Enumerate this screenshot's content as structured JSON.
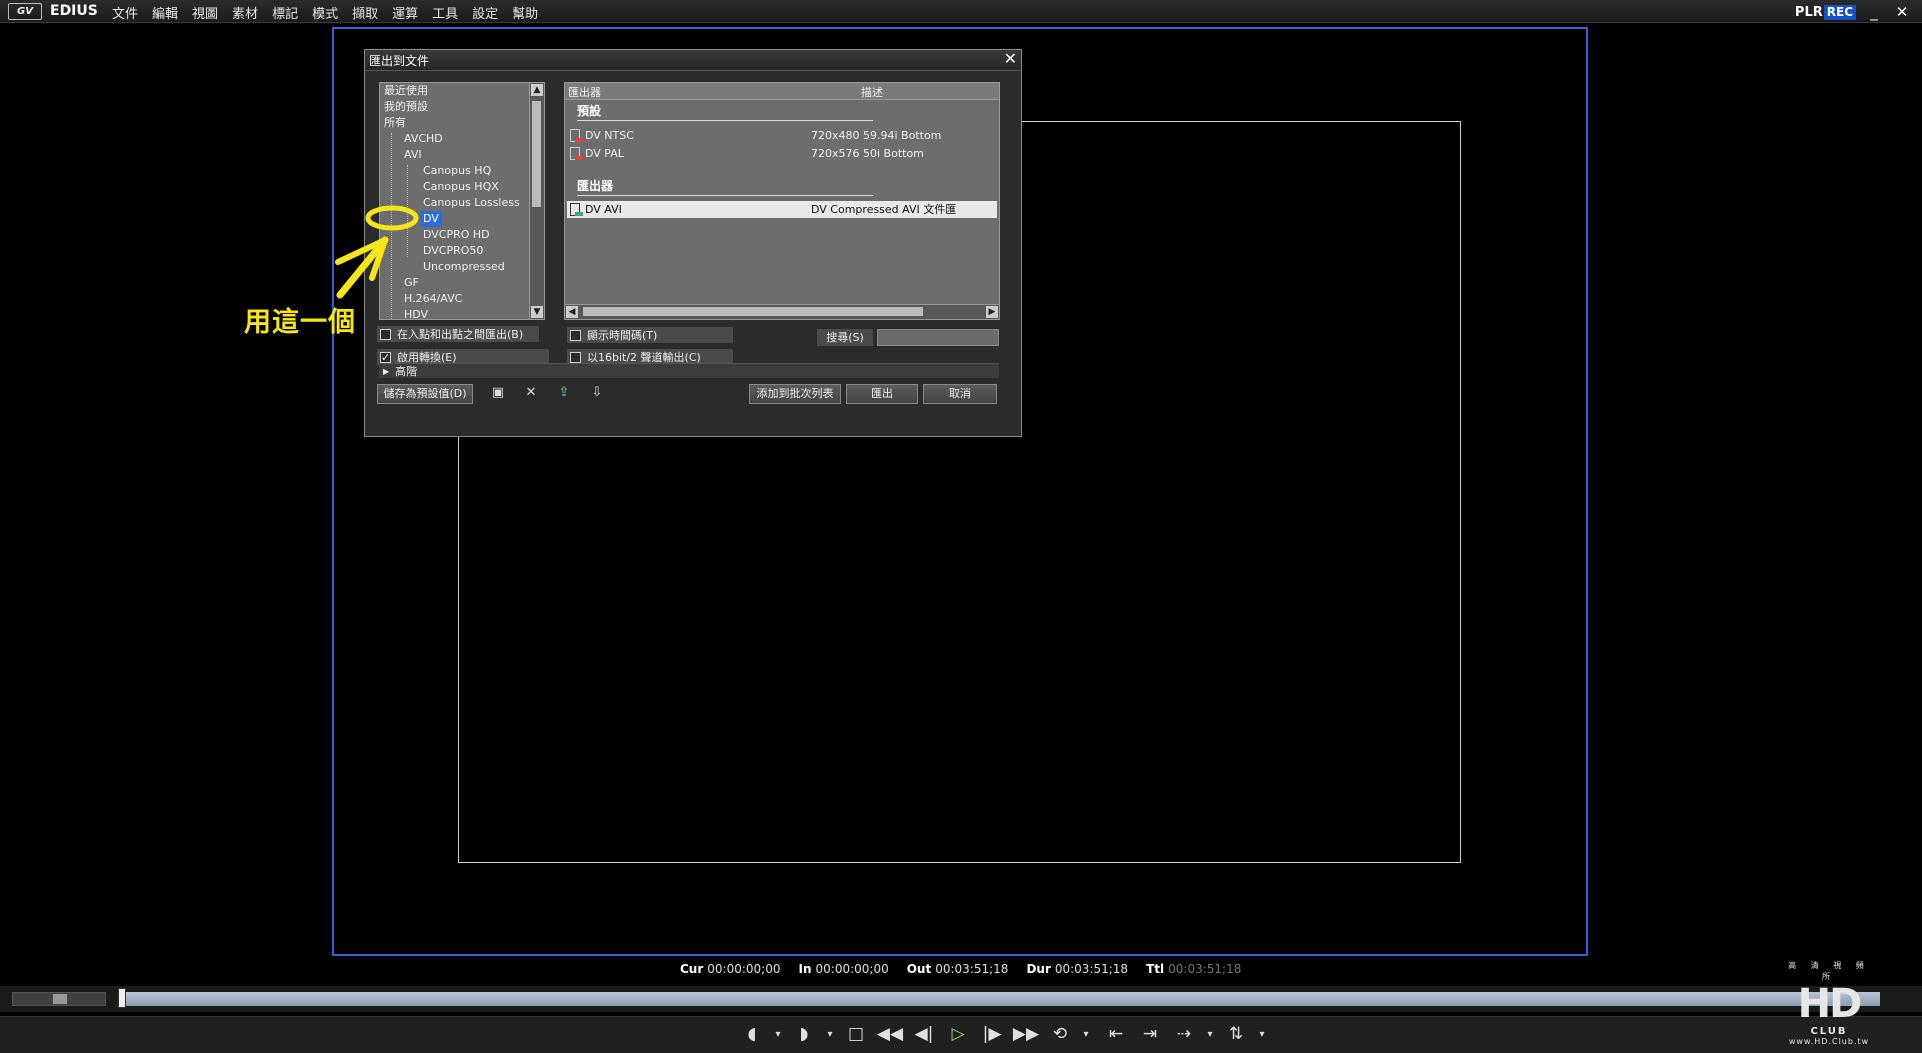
{
  "app": {
    "logo": "GV",
    "brand": "EDIUS",
    "menu": [
      "文件",
      "編輯",
      "視圖",
      "素材",
      "標記",
      "模式",
      "擷取",
      "運算",
      "工具",
      "設定",
      "幫助"
    ],
    "plr": "PLR",
    "rec": "REC",
    "minimize": "_",
    "close": "✕"
  },
  "dialog": {
    "title": "匯出到文件",
    "close": "✕",
    "tree": [
      {
        "label": "最近使用",
        "level": 0
      },
      {
        "label": "我的預設",
        "level": 0
      },
      {
        "label": "所有",
        "level": 0
      },
      {
        "label": "AVCHD",
        "level": 1
      },
      {
        "label": "AVI",
        "level": 1
      },
      {
        "label": "Canopus HQ",
        "level": 2
      },
      {
        "label": "Canopus HQX",
        "level": 2
      },
      {
        "label": "Canopus Lossless",
        "level": 2
      },
      {
        "label": "DV",
        "level": 2,
        "selected": true
      },
      {
        "label": "DVCPRO HD",
        "level": 2
      },
      {
        "label": "DVCPRO50",
        "level": 2
      },
      {
        "label": "Uncompressed",
        "level": 2
      },
      {
        "label": "GF",
        "level": 1
      },
      {
        "label": "H.264/AVC",
        "level": 1
      },
      {
        "label": "HDV",
        "level": 1
      }
    ],
    "list": {
      "col_exporter": "匯出器",
      "col_desc": "描述",
      "group_preset": "預設",
      "group_exporter": "匯出器",
      "presets": [
        {
          "name": "DV NTSC",
          "desc": "720x480 59.94i Bottom"
        },
        {
          "name": "DV PAL",
          "desc": "720x576 50i Bottom"
        }
      ],
      "exporters": [
        {
          "name": "DV AVI",
          "desc": "DV Compressed AVI 文件匯"
        }
      ]
    },
    "options": {
      "in_out": "在入點和出點之間匯出(B)",
      "enable_convert": "啟用轉換(E)",
      "enable_convert_checked": true,
      "show_timecode": "顯示時間碼(T)",
      "audio16": "以16bit/2 聲道輸出(C)",
      "search_label": "搜尋(S)",
      "search_value": "",
      "advanced": "高階"
    },
    "buttons": {
      "save_preset": "儲存為預設值(D)",
      "add_batch": "添加到批次列表",
      "export": "匯出",
      "cancel": "取消"
    }
  },
  "annotation": {
    "text": "用這一個",
    "color": "#f7e61a"
  },
  "timecodes": [
    {
      "label": "Cur",
      "value": "00:00:00;00"
    },
    {
      "label": "In",
      "value": "00:00:00;00"
    },
    {
      "label": "Out",
      "value": "00:03:51;18"
    },
    {
      "label": "Dur",
      "value": "00:03:51;18"
    },
    {
      "label": "Ttl",
      "value": "00:03:51;18",
      "dim": true
    }
  ],
  "watermark": {
    "top": "高 清 視 頻 所",
    "logo": "HD",
    "sub": "CLUB",
    "url": "www.HD.Club.tw"
  }
}
